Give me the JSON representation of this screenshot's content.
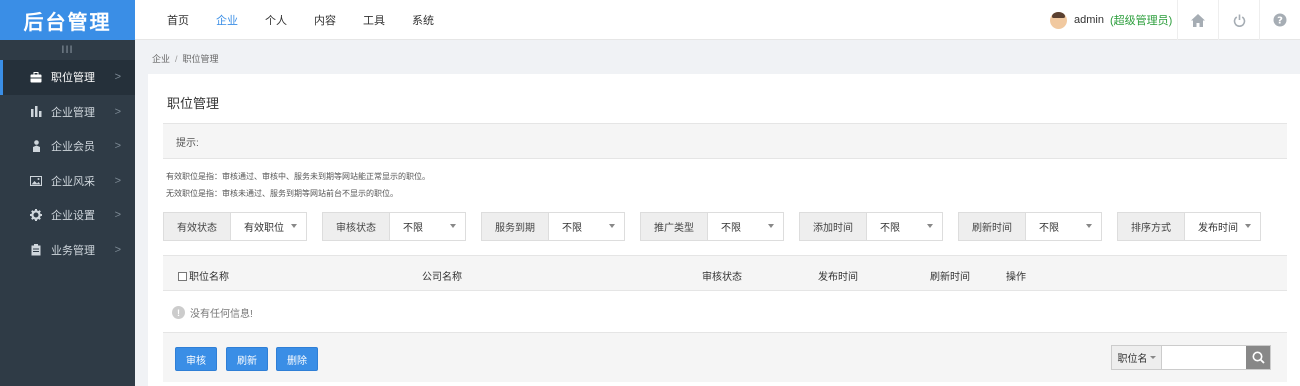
{
  "sidebar": {
    "logo": "后台管理",
    "collapse": "III",
    "items": [
      {
        "label": "职位管理",
        "active": true
      },
      {
        "label": "企业管理"
      },
      {
        "label": "企业会员"
      },
      {
        "label": "企业风采"
      },
      {
        "label": "企业设置"
      },
      {
        "label": "业务管理"
      }
    ]
  },
  "topnav": [
    "首页",
    "企业",
    "个人",
    "内容",
    "工具",
    "系统"
  ],
  "user": {
    "name": "admin",
    "role": "(超级管理员)"
  },
  "breadcrumb": {
    "parent": "企业",
    "sep": "/",
    "current": "职位管理"
  },
  "page": {
    "title": "职位管理",
    "tip_label": "提示:",
    "tip1": "有效职位是指：审核通过、审核中、服务未到期等网站能正常显示的职位。",
    "tip2": "无效职位是指：审核未通过、服务到期等网站前台不显示的职位。"
  },
  "filters": [
    {
      "label": "有效状态",
      "value": "有效职位"
    },
    {
      "label": "审核状态",
      "value": "不限"
    },
    {
      "label": "服务到期",
      "value": "不限"
    },
    {
      "label": "推广类型",
      "value": "不限"
    },
    {
      "label": "添加时间",
      "value": "不限"
    },
    {
      "label": "刷新时间",
      "value": "不限"
    },
    {
      "label": "排序方式",
      "value": "发布时间"
    }
  ],
  "table": {
    "columns": [
      "职位名称",
      "公司名称",
      "审核状态",
      "发布时间",
      "刷新时间",
      "操作"
    ],
    "empty": "没有任何信息!"
  },
  "actions": {
    "audit": "审核",
    "refresh": "刷新",
    "delete": "删除"
  },
  "search": {
    "field": "职位名",
    "placeholder": ""
  },
  "colors": {
    "accent": "#3a8ee6",
    "sidebar": "#2f3b46",
    "role": "#2a9d3a"
  }
}
